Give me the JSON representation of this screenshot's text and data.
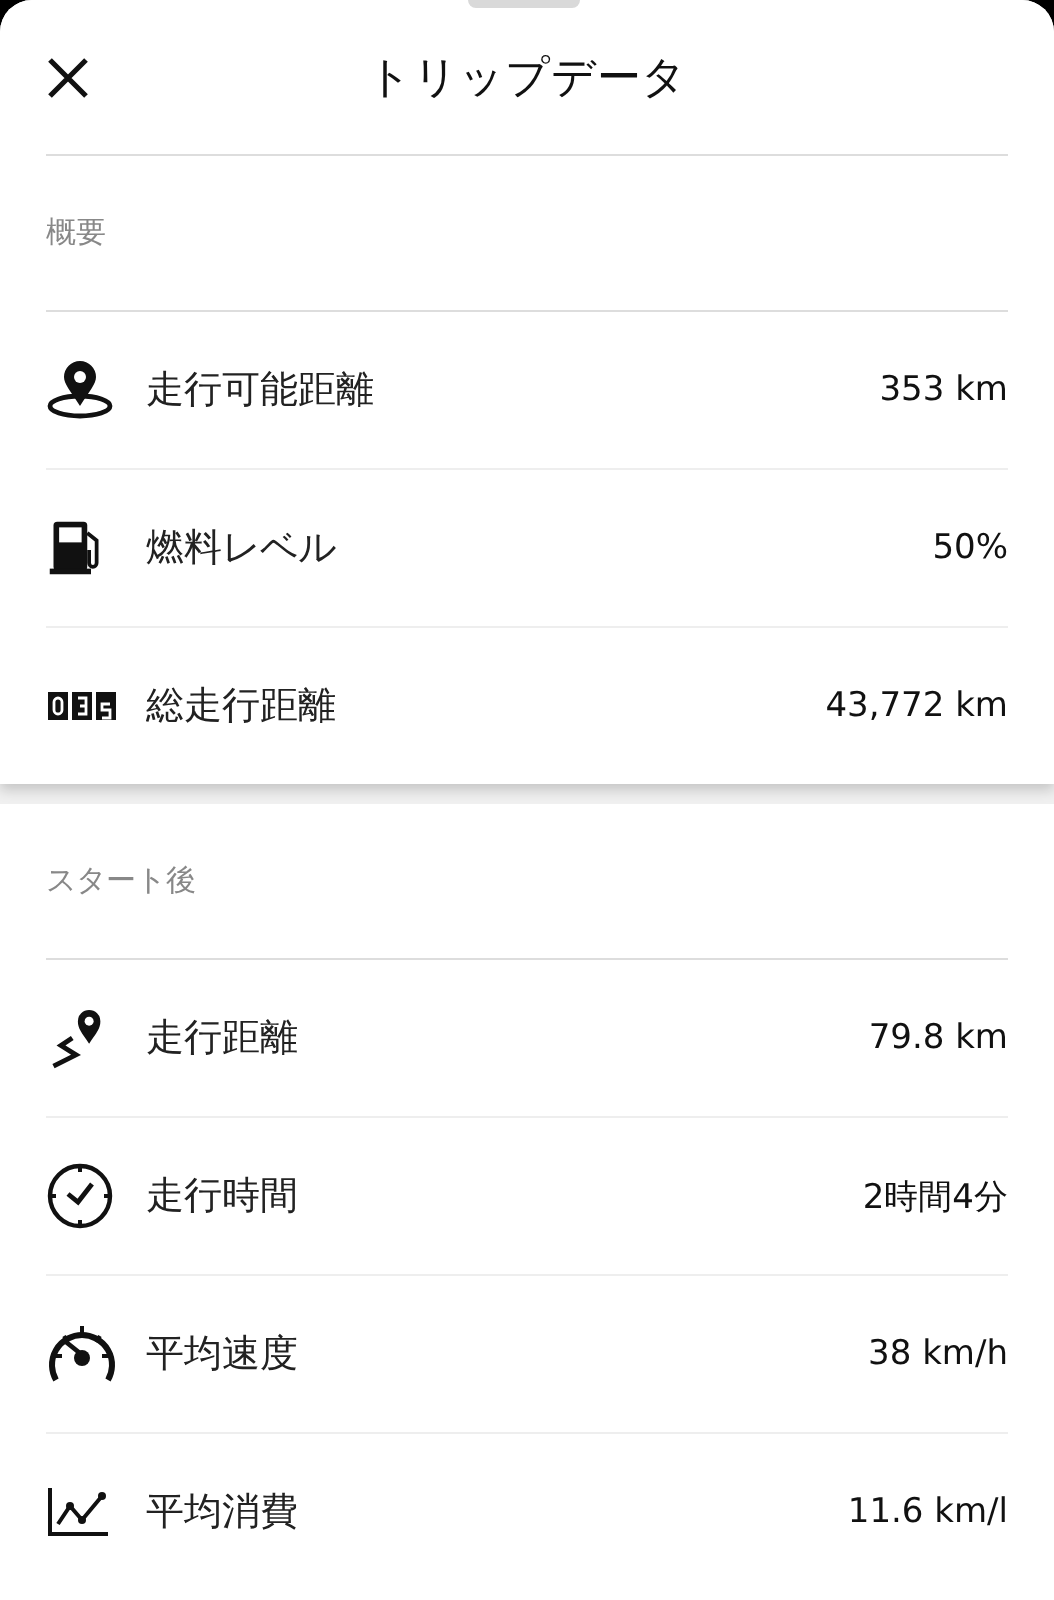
{
  "header": {
    "title": "トリップデータ"
  },
  "sections": [
    {
      "title": "概要",
      "rows": [
        {
          "kind": "pin",
          "label": "走行可能距離",
          "value": "353 km"
        },
        {
          "kind": "fuel",
          "label": "燃料レベル",
          "value": "50%"
        },
        {
          "kind": "odometer",
          "label": "総走行距離",
          "value": "43,772 km"
        }
      ]
    },
    {
      "title": "スタート後",
      "rows": [
        {
          "kind": "route",
          "label": "走行距離",
          "value": "79.8 km"
        },
        {
          "kind": "clock",
          "label": "走行時間",
          "value": "2時間4分"
        },
        {
          "kind": "gauge",
          "label": "平均速度",
          "value": "38 km/h"
        },
        {
          "kind": "chart",
          "label": "平均消費",
          "value": "11.6 km/l"
        }
      ]
    }
  ]
}
